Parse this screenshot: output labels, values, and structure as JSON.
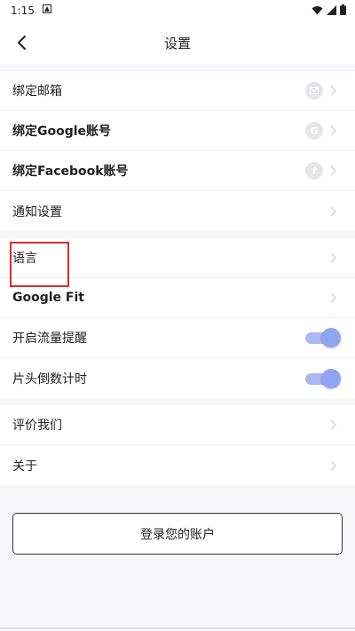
{
  "status_bar": {
    "time": "1:15"
  },
  "header": {
    "title": "设置"
  },
  "groups": [
    {
      "items": [
        {
          "label": "绑定邮箱",
          "icon": "mail-icon"
        },
        {
          "label": "绑定Google账号",
          "icon": "google-icon",
          "icon_glyph": "G"
        },
        {
          "label": "绑定Facebook账号",
          "icon": "facebook-icon",
          "icon_glyph": "f"
        },
        {
          "label": "通知设置"
        }
      ]
    },
    {
      "items": [
        {
          "label": "语言"
        },
        {
          "label": "Google Fit"
        },
        {
          "label": "开启流量提醒",
          "toggle": true
        },
        {
          "label": "片头倒数计时",
          "toggle": true
        }
      ]
    },
    {
      "items": [
        {
          "label": "评价我们"
        },
        {
          "label": "关于"
        }
      ]
    }
  ],
  "login_button": {
    "label": "登录您的账户"
  },
  "colors": {
    "toggle_on": "#8fa4f2",
    "highlight": "#e02a2a",
    "background": "#f6f6f8"
  }
}
